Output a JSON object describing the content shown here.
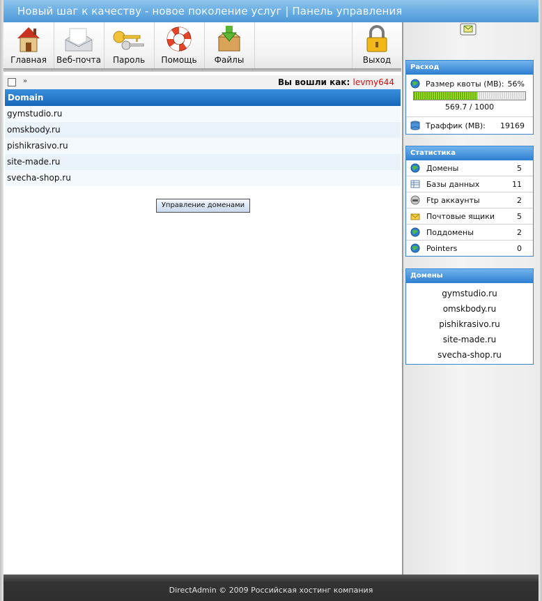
{
  "header": {
    "title": "Новый шаг к качеству - новое поколение услуг | Панель управления"
  },
  "toolbar": {
    "home": "Главная",
    "webmail": "Веб-почта",
    "password": "Пароль",
    "help": "Помощь",
    "files": "Файлы",
    "logout": "Выход"
  },
  "crumbs": {
    "raquo": "»",
    "logged_in_label": "Вы вошли как:",
    "username": "levmy644"
  },
  "table": {
    "header": "Domain",
    "rows": [
      "gymstudio.ru",
      "omskbody.ru",
      "pishikrasivo.ru",
      "site-made.ru",
      "svecha-shop.ru"
    ]
  },
  "manage_button": "Управление доменами",
  "usage": {
    "title": "Расход",
    "quota_label": "Размер квоты (МВ):",
    "quota_percent": "56%",
    "quota_fraction": 0.5697,
    "quota_value": "569.7 / 1000",
    "traffic_label": "Траффик (МВ):",
    "traffic_value": "19169"
  },
  "stats": {
    "title": "Статистика",
    "items": [
      {
        "label": "Домены",
        "value": "5"
      },
      {
        "label": "Базы данных",
        "value": "11"
      },
      {
        "label": "Ftp аккаунты",
        "value": "2"
      },
      {
        "label": "Почтовые ящики",
        "value": "5"
      },
      {
        "label": "Поддомены",
        "value": "2"
      },
      {
        "label": "Pointers",
        "value": "0"
      }
    ]
  },
  "domains_box": {
    "title": "Домены",
    "items": [
      "gymstudio.ru",
      "omskbody.ru",
      "pishikrasivo.ru",
      "site-made.ru",
      "svecha-shop.ru"
    ]
  },
  "footer": {
    "text": "DirectAdmin © 2009 Российская хостинг компания"
  }
}
